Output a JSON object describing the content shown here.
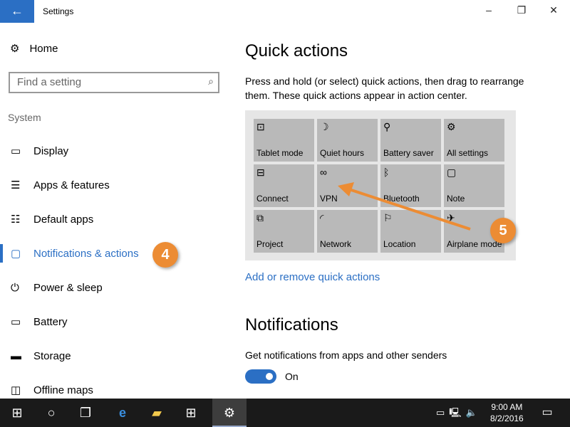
{
  "window": {
    "title": "Settings",
    "back_icon": "arrow-left-icon"
  },
  "sidebar": {
    "home": "Home",
    "search_placeholder": "Find a setting",
    "section": "System",
    "items": [
      {
        "label": "Display",
        "icon": "▭"
      },
      {
        "label": "Apps & features",
        "icon": "☰"
      },
      {
        "label": "Default apps",
        "icon": "☷"
      },
      {
        "label": "Notifications & actions",
        "icon": "▢",
        "active": true
      },
      {
        "label": "Power & sleep",
        "icon": "⏻"
      },
      {
        "label": "Battery",
        "icon": "▭"
      },
      {
        "label": "Storage",
        "icon": "▬"
      },
      {
        "label": "Offline maps",
        "icon": "◫"
      }
    ]
  },
  "main": {
    "quick_title": "Quick actions",
    "quick_desc": "Press and hold (or select) quick actions, then drag to rearrange them. These quick actions appear in action center.",
    "tiles": [
      {
        "label": "Tablet mode",
        "icon": "⊡"
      },
      {
        "label": "Quiet hours",
        "icon": "☽"
      },
      {
        "label": "Battery saver",
        "icon": "⚲"
      },
      {
        "label": "All settings",
        "icon": "⚙"
      },
      {
        "label": "Connect",
        "icon": "⊟"
      },
      {
        "label": "VPN",
        "icon": "∞"
      },
      {
        "label": "Bluetooth",
        "icon": "ᛒ"
      },
      {
        "label": "Note",
        "icon": "▢"
      },
      {
        "label": "Project",
        "icon": "⧉"
      },
      {
        "label": "Network",
        "icon": "◜"
      },
      {
        "label": "Location",
        "icon": "⚐"
      },
      {
        "label": "Airplane mode",
        "icon": "✈"
      }
    ],
    "add_link": "Add or remove quick actions",
    "notif_title": "Notifications",
    "notif_desc": "Get notifications from apps and other senders",
    "toggle_state": "On",
    "toggle_on": true
  },
  "callouts": [
    "4",
    "5"
  ],
  "accent": "#2b6fc4",
  "callout_color": "#ec8c34",
  "taskbar": {
    "time": "9:00 AM",
    "date": "8/2/2016"
  }
}
